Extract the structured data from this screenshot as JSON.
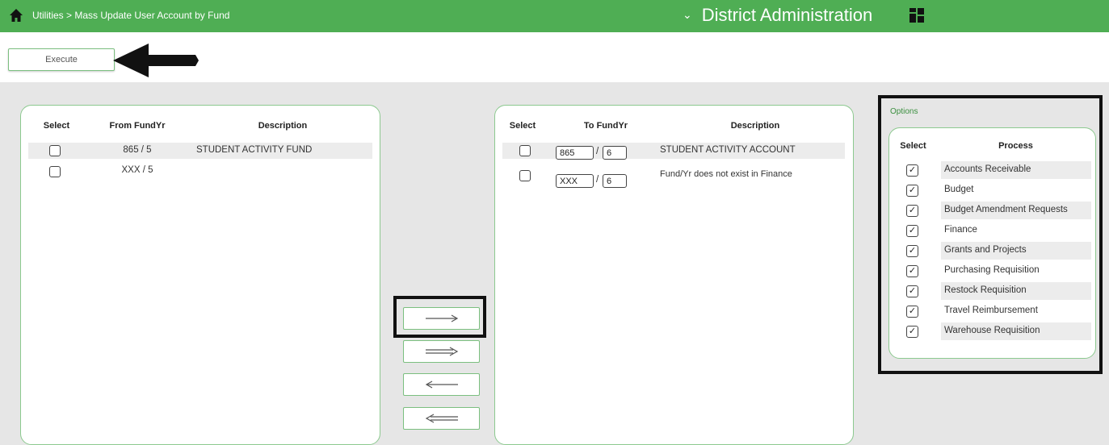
{
  "header": {
    "breadcrumb": "Utilities > Mass Update User Account by Fund",
    "district": "District Administration",
    "icons": {
      "home": "home-icon",
      "chevron": "chevron-down-icon",
      "apps": "grid-icon"
    }
  },
  "toolbar": {
    "execute_label": "Execute"
  },
  "from_table": {
    "headers": {
      "select": "Select",
      "fund": "From FundYr",
      "desc": "Description"
    },
    "rows": [
      {
        "fund": "865 / 5",
        "desc": "STUDENT ACTIVITY FUND"
      },
      {
        "fund": "XXX / 5",
        "desc": ""
      }
    ]
  },
  "to_table": {
    "headers": {
      "select": "Select",
      "fund": "To FundYr",
      "desc": "Description"
    },
    "rows": [
      {
        "fund": "865",
        "sep": "/",
        "yr": "6",
        "desc": "STUDENT ACTIVITY ACCOUNT"
      },
      {
        "fund": "XXX",
        "sep": "/",
        "yr": "6",
        "desc": "Fund/Yr does not exist in Finance"
      }
    ]
  },
  "move_buttons": [
    "move-selected-right",
    "move-all-right",
    "move-selected-left",
    "move-all-left"
  ],
  "options": {
    "title": "Options",
    "headers": {
      "select": "Select",
      "process": "Process"
    },
    "items": [
      {
        "label": "Accounts Receivable",
        "checked": true
      },
      {
        "label": "Budget",
        "checked": true
      },
      {
        "label": "Budget Amendment Requests",
        "checked": true
      },
      {
        "label": "Finance",
        "checked": true
      },
      {
        "label": "Grants and Projects",
        "checked": true
      },
      {
        "label": "Purchasing Requisition",
        "checked": true
      },
      {
        "label": "Restock Requisition",
        "checked": true
      },
      {
        "label": "Travel Reimbursement",
        "checked": true
      },
      {
        "label": "Warehouse Requisition",
        "checked": true
      }
    ],
    "check_glyph": "✓"
  }
}
